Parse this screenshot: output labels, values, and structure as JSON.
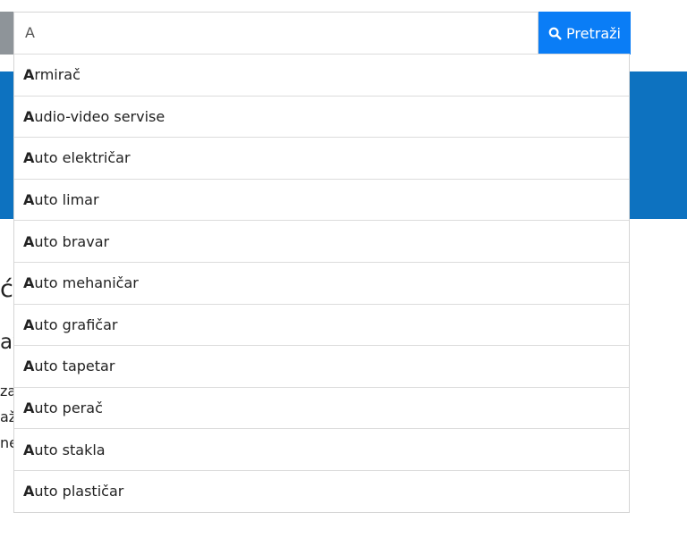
{
  "search": {
    "query": "A",
    "button_label": "Pretraži",
    "button_icon": "search-icon"
  },
  "suggestions": [
    {
      "match": "A",
      "rest": "rmirač"
    },
    {
      "match": "A",
      "rest": "udio-video servise"
    },
    {
      "match": "A",
      "rest": "uto električar"
    },
    {
      "match": "A",
      "rest": "uto limar"
    },
    {
      "match": "A",
      "rest": "uto bravar"
    },
    {
      "match": "A",
      "rest": "uto mehaničar"
    },
    {
      "match": "A",
      "rest": "uto grafičar"
    },
    {
      "match": "A",
      "rest": "uto tapetar"
    },
    {
      "match": "A",
      "rest": "uto perač"
    },
    {
      "match": "A",
      "rest": "uto stakla"
    },
    {
      "match": "A",
      "rest": "uto plastičar"
    }
  ],
  "background": {
    "heading_fragment": "će",
    "subheading_fragment": "av",
    "text_fragments": [
      "za",
      "až",
      "ne"
    ]
  },
  "colors": {
    "accent": "#0a7df6",
    "hero": "#0d72c0",
    "border": "#d5d5d5"
  }
}
